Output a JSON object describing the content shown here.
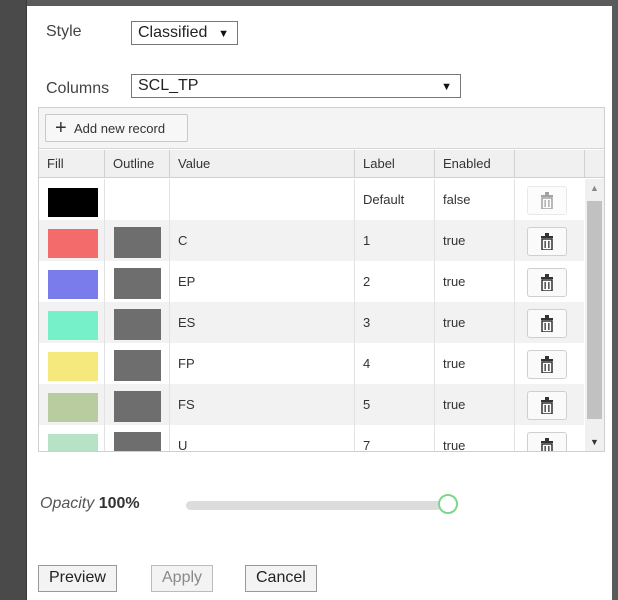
{
  "style": {
    "label": "Style",
    "value": "Classified"
  },
  "columns": {
    "label": "Columns",
    "value": "SCL_TP"
  },
  "toolbar": {
    "add_label": "Add new record"
  },
  "grid": {
    "headers": [
      "Fill",
      "Outline",
      "Value",
      "Label",
      "Enabled",
      ""
    ],
    "rows": [
      {
        "fill": "#000000",
        "outline": "",
        "value": "",
        "label": "Default",
        "enabled": "false"
      },
      {
        "fill": "#f46b6b",
        "outline": "#6e6e6e",
        "value": "C",
        "label": "1",
        "enabled": "true"
      },
      {
        "fill": "#7b7cec",
        "outline": "#6e6e6e",
        "value": "EP",
        "label": "2",
        "enabled": "true"
      },
      {
        "fill": "#75f0c9",
        "outline": "#6e6e6e",
        "value": "ES",
        "label": "3",
        "enabled": "true"
      },
      {
        "fill": "#f5e87d",
        "outline": "#6e6e6e",
        "value": "FP",
        "label": "4",
        "enabled": "true"
      },
      {
        "fill": "#b9cc9f",
        "outline": "#6e6e6e",
        "value": "FS",
        "label": "5",
        "enabled": "true"
      },
      {
        "fill": "#b6e2c6",
        "outline": "#6e6e6e",
        "value": "U",
        "label": "7",
        "enabled": "true"
      }
    ]
  },
  "opacity": {
    "label": "Opacity",
    "value_text": "100%",
    "value": 1.0
  },
  "buttons": {
    "preview": "Preview",
    "apply": "Apply",
    "cancel": "Cancel"
  },
  "icons": {
    "add": "plus-icon",
    "delete": "trash-icon",
    "dropdown": "caret-down-icon"
  }
}
